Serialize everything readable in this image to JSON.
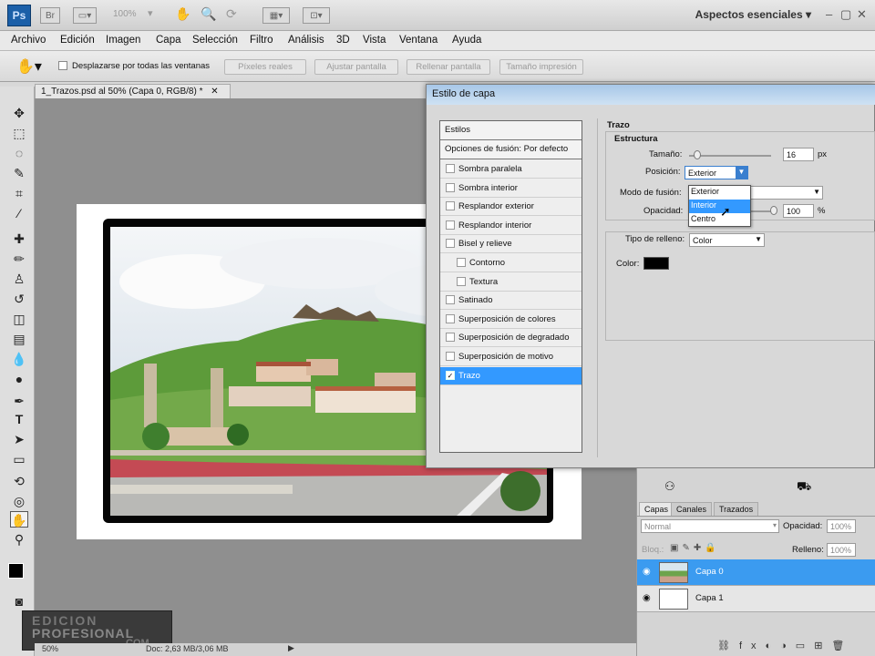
{
  "app": {
    "logo": "Ps",
    "zoom": "100%",
    "workspace": "Aspectos esenciales"
  },
  "menu": [
    "Archivo",
    "Edición",
    "Imagen",
    "Capa",
    "Selección",
    "Filtro",
    "Análisis",
    "3D",
    "Vista",
    "Ventana",
    "Ayuda"
  ],
  "options": {
    "scroll_all_label": "Desplazarse por todas las ventanas",
    "buttons": [
      "Píxeles reales",
      "Ajustar pantalla",
      "Rellenar pantalla",
      "Tamaño impresión"
    ]
  },
  "document": {
    "tab_title": "1_Trazos.psd al 50% (Capa 0, RGB/8) *"
  },
  "status": {
    "zoom": "50%",
    "doc_size": "Doc: 2,63 MB/3,06 MB"
  },
  "watermark": {
    "line1": "EDICION",
    "line2": "PROFESIONAL",
    "line3": ".COM"
  },
  "dialog": {
    "title": "Estilo de capa",
    "list_header": "Estilos",
    "blend_header": "Opciones de fusión: Por defecto",
    "styles": [
      {
        "label": "Sombra paralela",
        "checked": false,
        "sub": false
      },
      {
        "label": "Sombra interior",
        "checked": false,
        "sub": false
      },
      {
        "label": "Resplandor exterior",
        "checked": false,
        "sub": false
      },
      {
        "label": "Resplandor interior",
        "checked": false,
        "sub": false
      },
      {
        "label": "Bisel y relieve",
        "checked": false,
        "sub": false
      },
      {
        "label": "Contorno",
        "checked": false,
        "sub": true
      },
      {
        "label": "Textura",
        "checked": false,
        "sub": true
      },
      {
        "label": "Satinado",
        "checked": false,
        "sub": false
      },
      {
        "label": "Superposición de colores",
        "checked": false,
        "sub": false
      },
      {
        "label": "Superposición de degradado",
        "checked": false,
        "sub": false
      },
      {
        "label": "Superposición de motivo",
        "checked": false,
        "sub": false
      },
      {
        "label": "Trazo",
        "checked": true,
        "sub": false
      }
    ],
    "section_title": "Trazo",
    "structure_title": "Estructura",
    "size_label": "Tamaño:",
    "size_value": "16",
    "size_unit": "px",
    "position_label": "Posición:",
    "position_value": "Exterior",
    "position_options": [
      "Exterior",
      "Interior",
      "Centro"
    ],
    "blend_mode_label": "Modo de fusión:",
    "opacity_label": "Opacidad:",
    "opacity_value": "100",
    "opacity_unit": "%",
    "fill_type_label": "Tipo de relleno:",
    "fill_type_value": "Color",
    "color_label": "Color:",
    "stroke_color": "#000000"
  },
  "layers_panel": {
    "tabs": [
      "Capas",
      "Canales",
      "Trazados"
    ],
    "blend_mode": "Normal",
    "opacity_label": "Opacidad:",
    "opacity_value": "100%",
    "lock_label": "Bloq.:",
    "fill_label": "Relleno:",
    "fill_value": "100%",
    "layers": [
      {
        "name": "Capa 0",
        "selected": true
      },
      {
        "name": "Capa 1",
        "selected": false
      }
    ]
  },
  "colors": {
    "accent": "#3399ff",
    "selected_layer": "#3b9bf0"
  }
}
